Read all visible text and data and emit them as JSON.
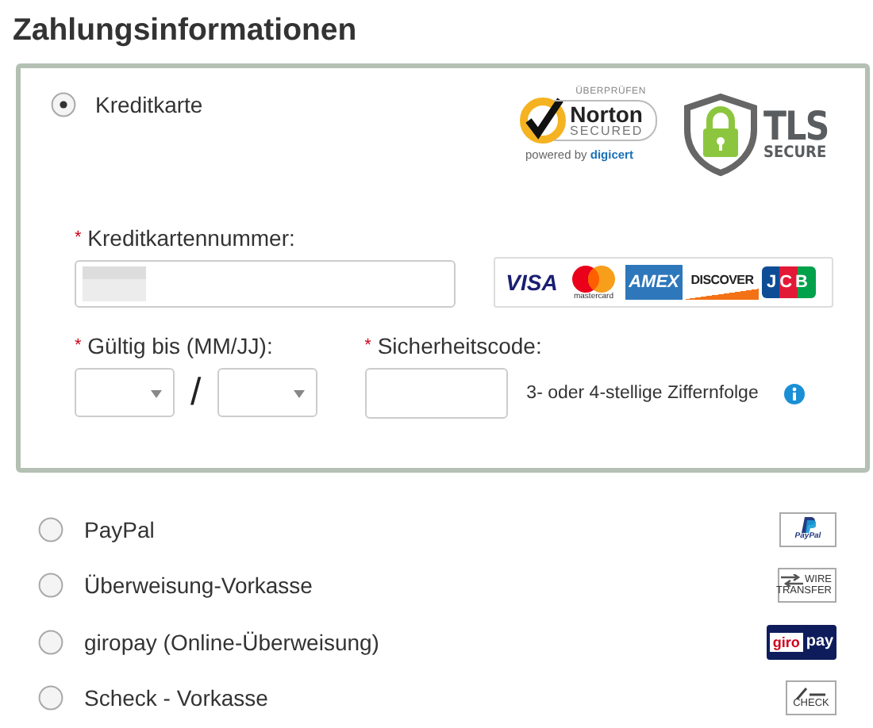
{
  "title": "Zahlungsinformationen",
  "methods": [
    {
      "kind": "card",
      "label": "Kreditkarte",
      "selected": true,
      "norton": {
        "top": "ÜBERPRÜFEN",
        "name": "Norton",
        "sub": "SECURED",
        "powered": "powered by",
        "brand": "digicert"
      },
      "tls": {
        "name": "TLS",
        "sub": "SECURE"
      },
      "card_number": {
        "mark": "*",
        "label": "Kreditkartennummer:"
      },
      "card_logos": [
        {
          "kind": "visa",
          "text": "VISA"
        },
        {
          "kind": "mastercard",
          "text": "mastercard"
        },
        {
          "kind": "amex",
          "text": "AMEX"
        },
        {
          "kind": "discover",
          "text": "DISCOVER"
        },
        {
          "kind": "jcb",
          "text": "JCB"
        }
      ],
      "expiry": {
        "mark": "*",
        "label": "Gültig bis (MM/JJ):",
        "separator": "/"
      },
      "security": {
        "mark": "*",
        "label": "Sicherheitscode:",
        "hint": "3- oder 4-stellige Ziffernfolge"
      }
    },
    {
      "kind": "paypal",
      "label": "PayPal",
      "selected": false,
      "logo": [
        "PayPal"
      ]
    },
    {
      "kind": "wire",
      "label": "Überweisung-Vorkasse",
      "selected": false,
      "logo": [
        "WIRE",
        "TRANSFER"
      ]
    },
    {
      "kind": "giropay",
      "label": "giropay (Online-Überweisung)",
      "selected": false,
      "logo": [
        "giro",
        "pay"
      ]
    },
    {
      "kind": "check",
      "label": "Scheck - Vorkasse",
      "selected": false,
      "logo": [
        "CHECK"
      ]
    }
  ]
}
